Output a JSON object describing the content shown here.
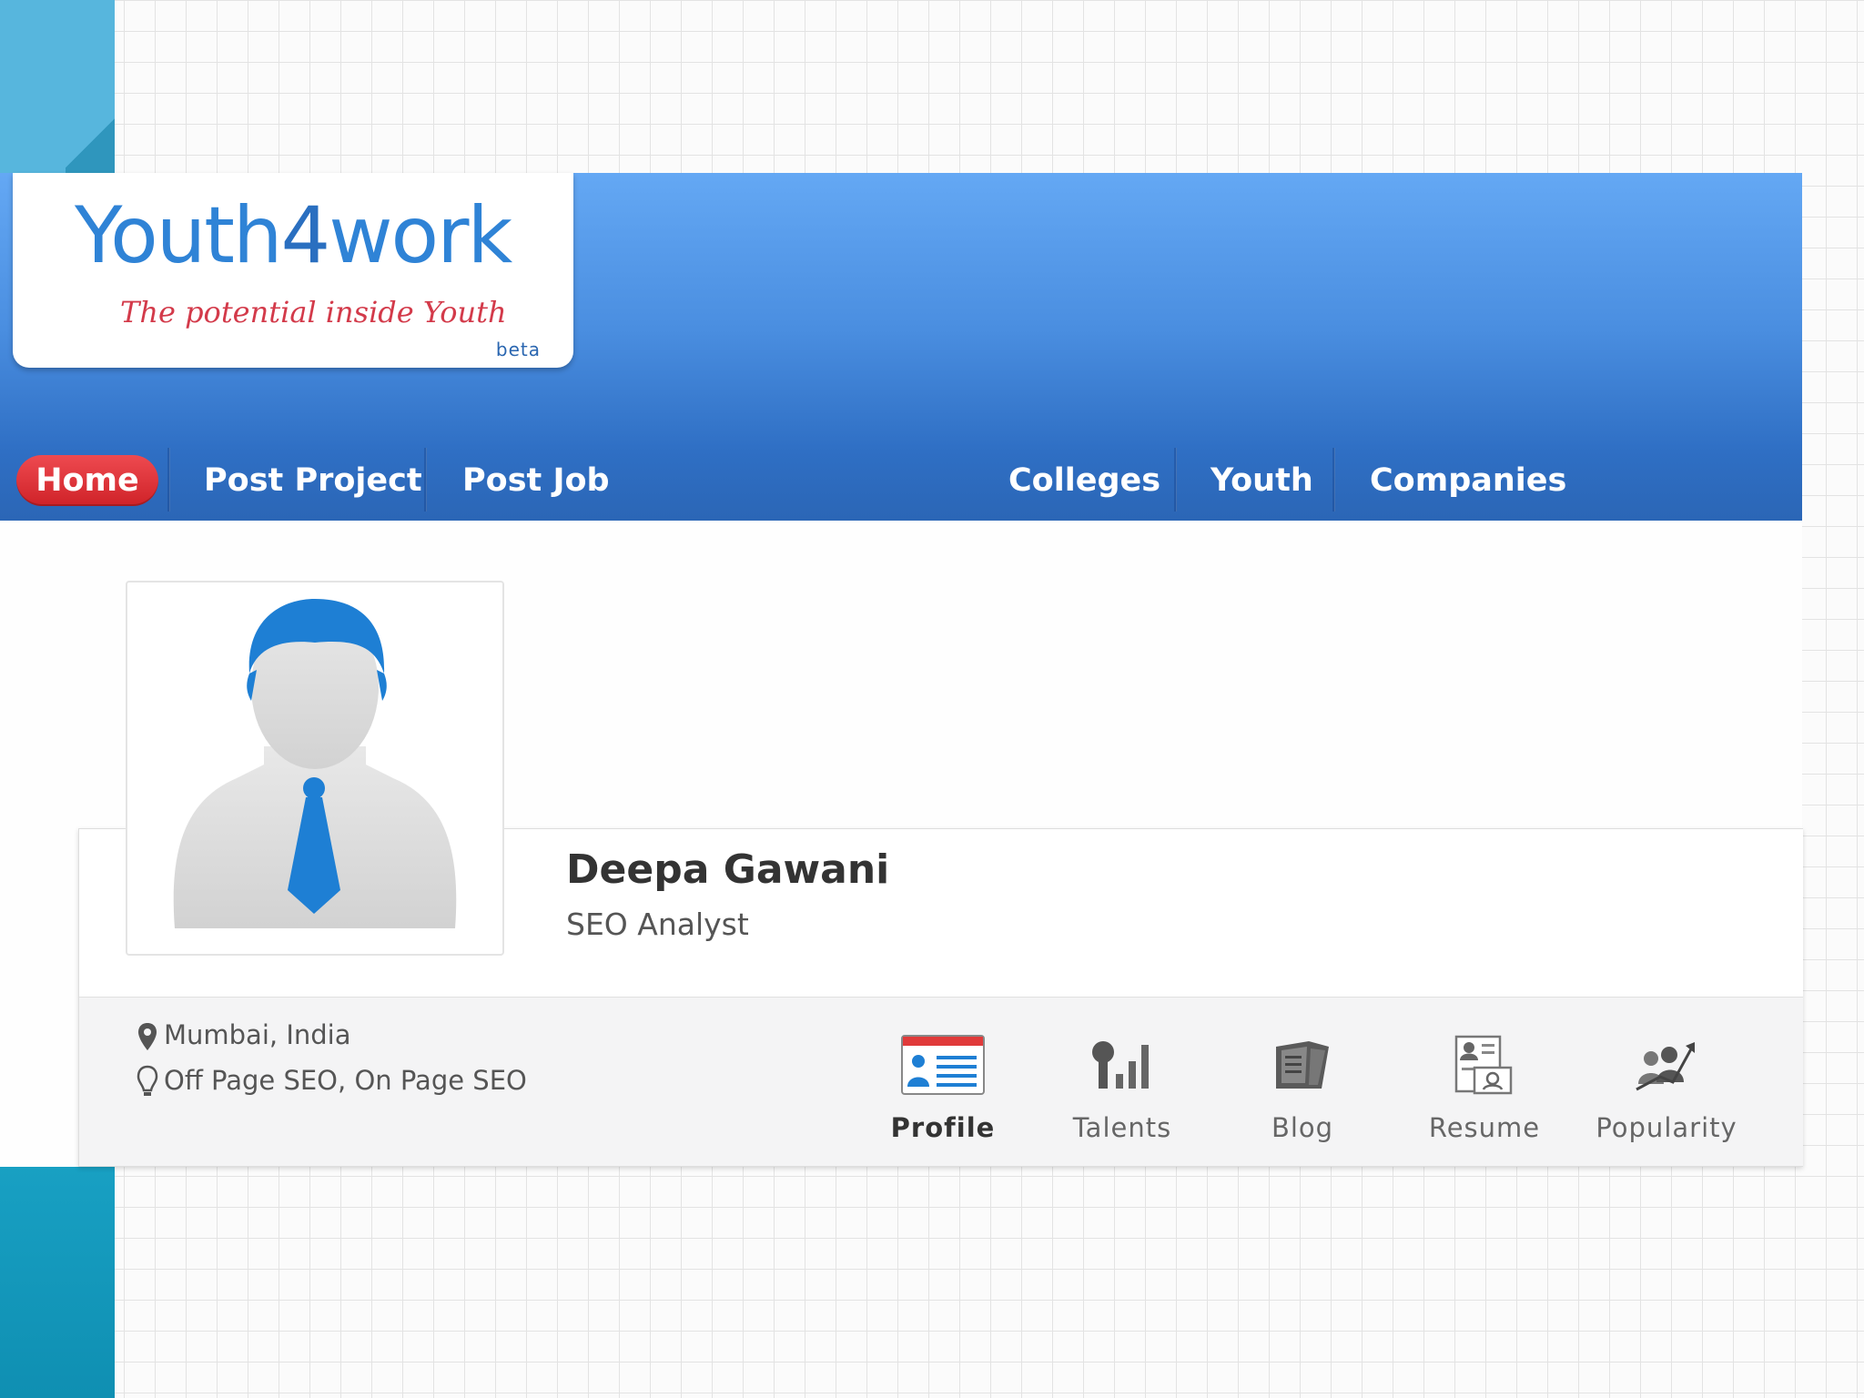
{
  "brand": {
    "name_part1": "Youth",
    "name_digit": "4",
    "name_part2": "work",
    "tagline": "The potential inside Youth",
    "badge": "beta"
  },
  "nav": {
    "home": "Home",
    "post_project": "Post Project",
    "post_job": "Post Job",
    "colleges": "Colleges",
    "youth": "Youth",
    "companies": "Companies"
  },
  "profile": {
    "name": "Deepa Gawani",
    "title": "SEO Analyst",
    "location": "Mumbai, India",
    "skills": "Off Page SEO, On Page SEO"
  },
  "tabs": {
    "profile": "Profile",
    "talents": "Talents",
    "blog": "Blog",
    "resume": "Resume",
    "popularity": "Popularity"
  },
  "colors": {
    "header_blue": "#4a8ee0",
    "home_red": "#d9282e",
    "logo_blue": "#2f83d6",
    "tagline_red": "#d33a4a",
    "avatar_blue": "#1e7fd4"
  },
  "icons": [
    "map-pin-icon",
    "lightbulb-icon",
    "profile-card-icon",
    "talents-bars-icon",
    "blog-book-icon",
    "resume-icon",
    "popularity-icon"
  ]
}
